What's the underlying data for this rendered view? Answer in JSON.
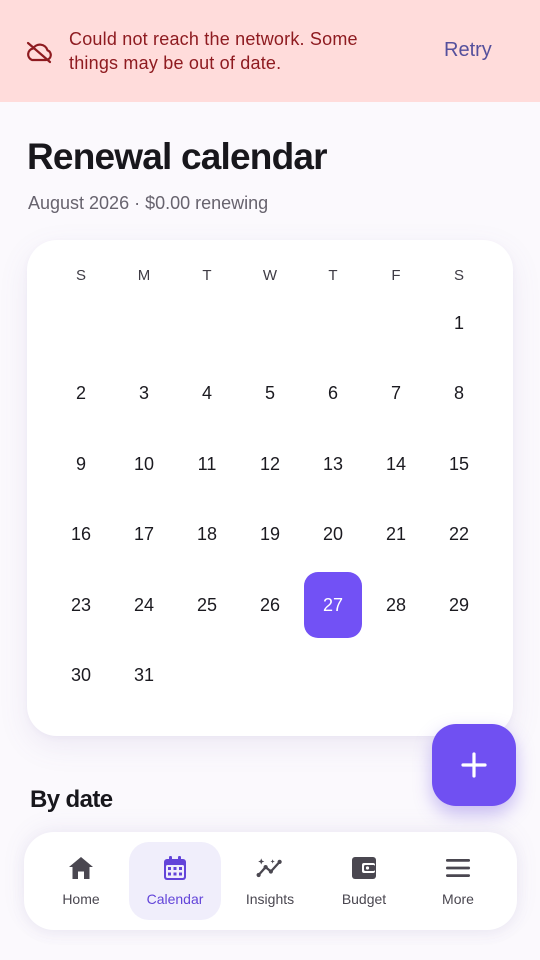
{
  "banner": {
    "icon": "cloud-off-icon",
    "message": "Could not reach the network. Some things may be out of date.",
    "retry_label": "Retry"
  },
  "header": {
    "title": "Renewal calendar",
    "subtitle": "August 2026 · $0.00 renewing"
  },
  "calendar": {
    "weekdays": [
      "S",
      "M",
      "T",
      "W",
      "T",
      "F",
      "S"
    ],
    "days": [
      "1",
      "2",
      "3",
      "4",
      "5",
      "6",
      "7",
      "8",
      "9",
      "10",
      "11",
      "12",
      "13",
      "14",
      "15",
      "16",
      "17",
      "18",
      "19",
      "20",
      "21",
      "22",
      "23",
      "24",
      "25",
      "26",
      "27",
      "28",
      "29",
      "30",
      "31"
    ],
    "selected_day": "27",
    "accent": "#7251f5"
  },
  "fab": {
    "icon": "plus-icon"
  },
  "section": {
    "title": "By date"
  },
  "nav": {
    "items": [
      {
        "label": "Home",
        "icon": "home-icon"
      },
      {
        "label": "Calendar",
        "icon": "calendar-icon"
      },
      {
        "label": "Insights",
        "icon": "insights-icon"
      },
      {
        "label": "Budget",
        "icon": "wallet-icon"
      },
      {
        "label": "More",
        "icon": "menu-icon"
      }
    ],
    "active": "Calendar"
  }
}
